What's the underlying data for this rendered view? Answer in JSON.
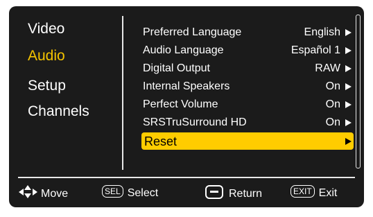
{
  "categories": [
    "Video",
    "Audio",
    "Setup",
    "Channels"
  ],
  "active_category": "Audio",
  "items": [
    {
      "label": "Preferred Language",
      "value": "English"
    },
    {
      "label": "Audio Language",
      "value": "Español 1"
    },
    {
      "label": "Digital Output",
      "value": "RAW"
    },
    {
      "label": "Internal Speakers",
      "value": "On"
    },
    {
      "label": "Perfect Volume",
      "value": "On"
    },
    {
      "label": "SRSTruSurround HD",
      "value": "On"
    },
    {
      "label": "Reset",
      "value": ""
    }
  ],
  "selected_item": "Reset",
  "footer": {
    "move_label": "Move",
    "sel_key": "SEL",
    "select_label": "Select",
    "return_label": "Return",
    "exit_key": "EXIT",
    "exit_label": "Exit"
  },
  "colors": {
    "background": "#1b1b1b",
    "accent": "#ffcc00",
    "active_text": "#f5c400"
  }
}
